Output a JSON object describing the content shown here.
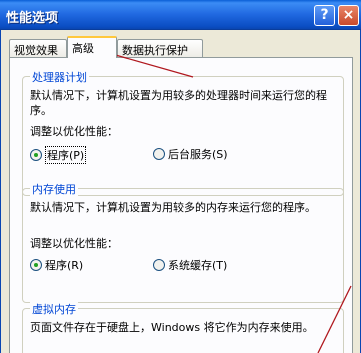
{
  "window": {
    "title": "性能选项",
    "help_label": "?",
    "close_label": "×"
  },
  "tabs": [
    {
      "label": "视觉效果"
    },
    {
      "label": "高级"
    },
    {
      "label": "数据执行保护"
    }
  ],
  "processor": {
    "heading": "处理器计划",
    "description": "默认情况下，计算机设置为用较多的处理器时间来运行您的程序。",
    "adjust_label": "调整以优化性能：",
    "options": [
      {
        "label": "程序(P)",
        "selected": true
      },
      {
        "label": "后台服务(S)",
        "selected": false
      }
    ]
  },
  "memory": {
    "heading": "内存使用",
    "description": "默认情况下，计算机设置为用较多的内存来运行您的程序。",
    "adjust_label": "调整以优化性能：",
    "options": [
      {
        "label": "程序(R)",
        "selected": true
      },
      {
        "label": "系统缓存(T)",
        "selected": false
      }
    ]
  },
  "virtual_memory": {
    "heading": "虚拟内存",
    "description": "页面文件存在于硬盘上，Windows 将它作为内存来使用。"
  },
  "colors": {
    "titlebar": "#0a5fd6",
    "accent_heading": "#0046d5",
    "annotation_arrow": "#b0181e"
  }
}
